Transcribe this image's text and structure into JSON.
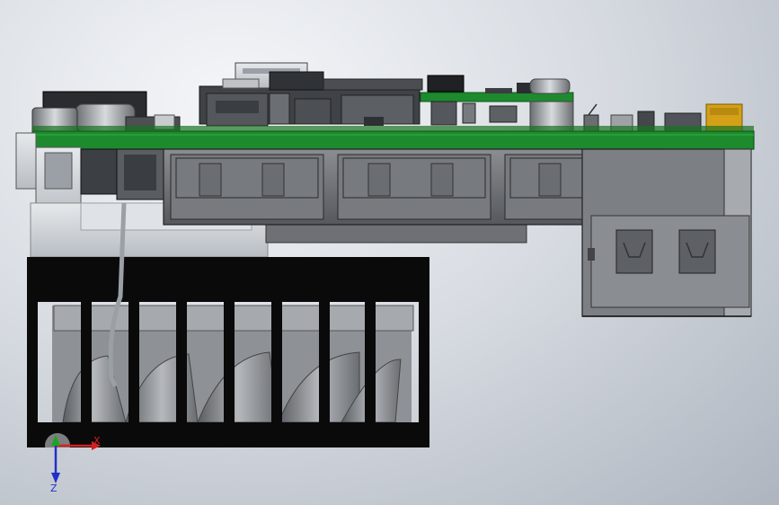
{
  "viewport": {
    "title": "",
    "background_top": "#f4f6f9",
    "background_bottom": "#aeb5bf"
  },
  "colors": {
    "pcb_green": "#1e8a2e",
    "pcb_dark": "#0f5a18",
    "housing_grey": "#6e7176",
    "fan_guard": "#0a0a0a",
    "connector_gold": "#d4a017",
    "axis_x": "#d42020",
    "axis_y": "#1ea51e",
    "axis_z": "#2030c8"
  },
  "triad": {
    "x_label": "X",
    "z_label": "Z",
    "icon": "coordinate-triad-icon"
  }
}
